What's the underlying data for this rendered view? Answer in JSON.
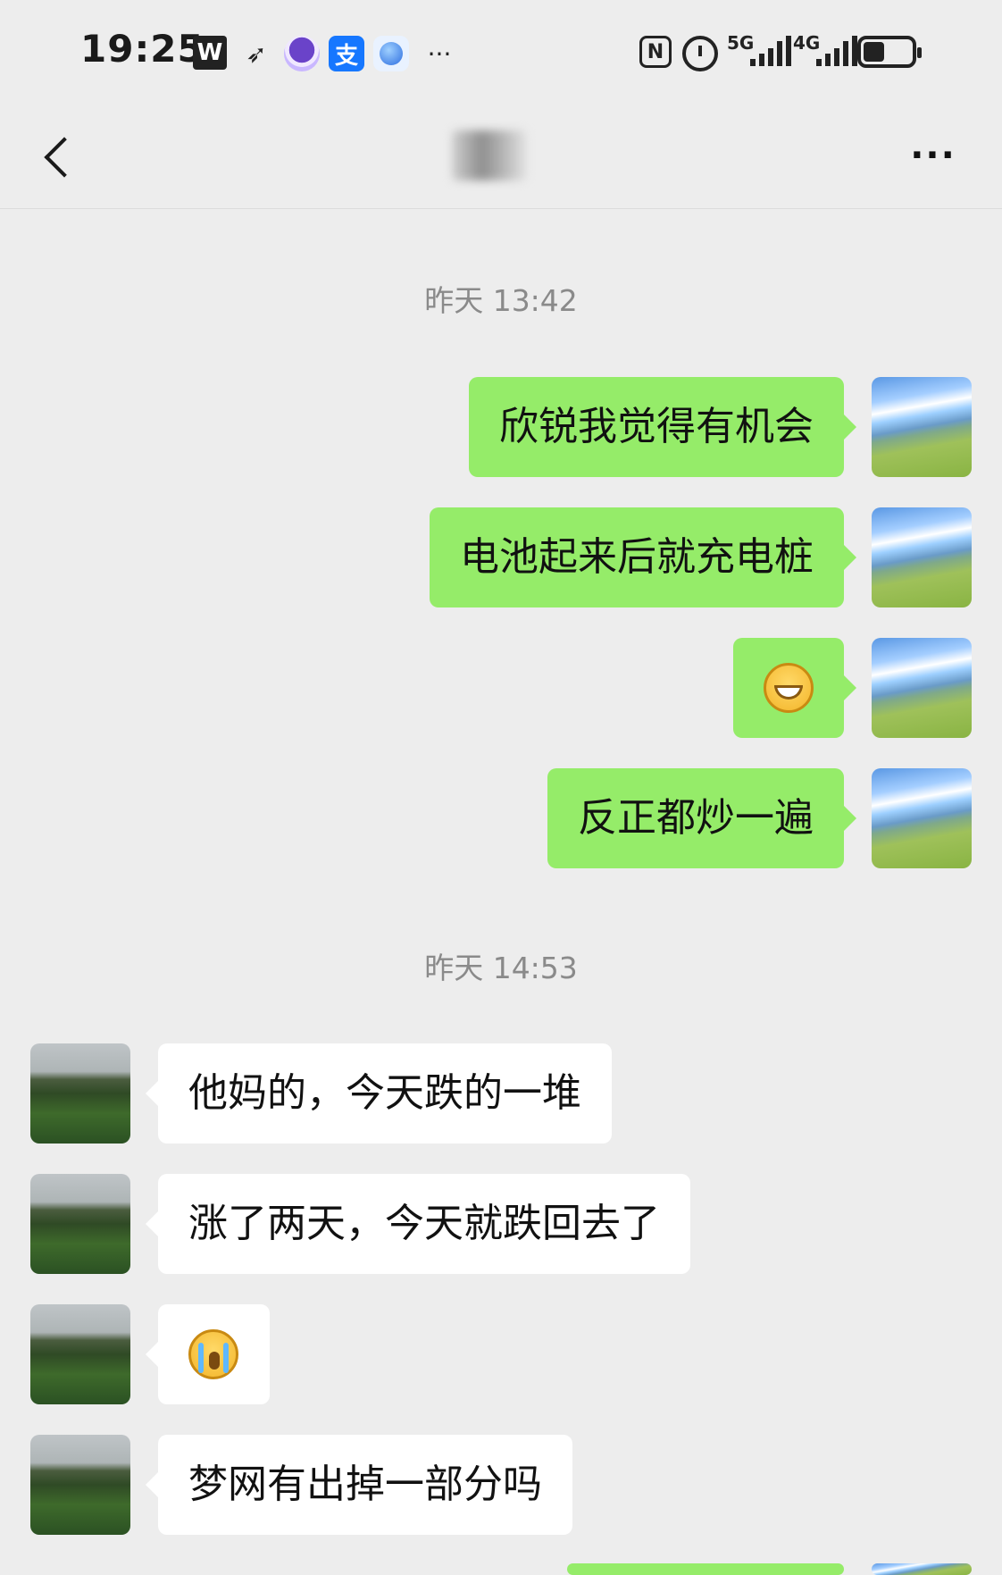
{
  "status_bar": {
    "time": "19:25",
    "app_icons": [
      "wps-icon",
      "paper-plane-icon",
      "app-circle-icon",
      "alipay-icon",
      "browser-icon"
    ],
    "overflow": "···",
    "nfc_label": "N",
    "signal_1": "5G",
    "signal_2": "4G",
    "battery_level": 0.45
  },
  "header": {
    "more_label": "···"
  },
  "chat": {
    "timestamp_1": "昨天 13:42",
    "timestamp_2": "昨天 14:53",
    "messages": [
      {
        "sender": "self",
        "text": "欣锐我觉得有机会"
      },
      {
        "sender": "self",
        "text": "电池起来后就充电桩"
      },
      {
        "sender": "self",
        "emoji": "grin-emoji"
      },
      {
        "sender": "self",
        "text": "反正都炒一遍"
      },
      {
        "sender": "other",
        "text": "他妈的，今天跌的一堆"
      },
      {
        "sender": "other",
        "text": "涨了两天，今天就跌回去了"
      },
      {
        "sender": "other",
        "emoji": "crying-emoji"
      },
      {
        "sender": "other",
        "text": "梦网有出掉一部分吗"
      }
    ]
  },
  "colors": {
    "background": "#ededed",
    "self_bubble": "#95ec69",
    "other_bubble": "#ffffff",
    "timestamp": "#8a8a8a"
  }
}
